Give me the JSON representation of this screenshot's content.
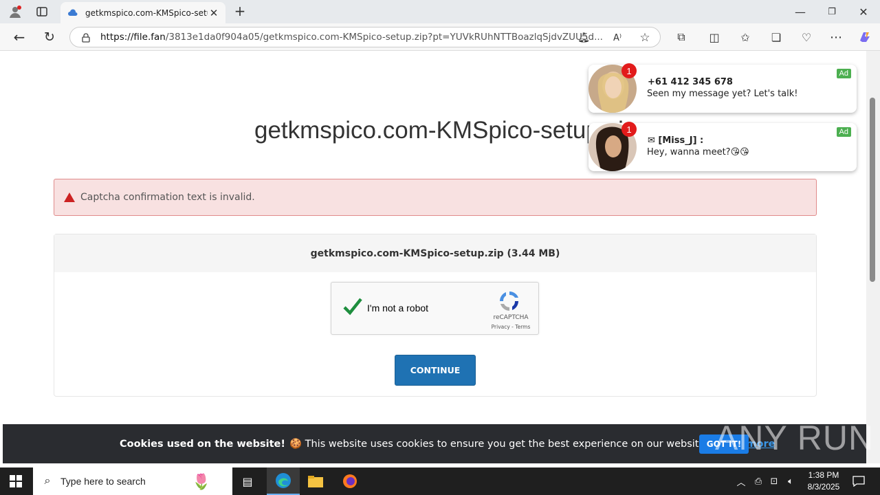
{
  "browser": {
    "tab_title": "getkmspico.com-KMSpico-setup.zip",
    "url_domain": "https://file.fan",
    "url_path": "/3813e1da0f904a05/getkmspico.com-KMSpico-setup.zip?pt=YUVkRUhNTTBoazlqSjdvZUU5d..."
  },
  "page": {
    "title": "getkmspico.com-KMSpico-setup.zip",
    "alert_text": "Captcha confirmation text is invalid.",
    "file_info": "getkmspico.com-KMSpico-setup.zip (3.44 MB)",
    "recaptcha": {
      "label": "I'm not a robot",
      "brand": "reCAPTCHA",
      "links": "Privacy - Terms"
    },
    "continue_label": "CONTINUE"
  },
  "ads": [
    {
      "name": "+61 412 345 678",
      "message": "Seen my message yet? Let's talk!",
      "badge": "1",
      "tag": "Ad"
    },
    {
      "name": "✉ [Miss_J] :",
      "message": "Hey, wanna meet?😘😘",
      "badge": "1",
      "tag": "Ad"
    }
  ],
  "cookie": {
    "heading": "Cookies used on the website!",
    "text": "🍪 This website uses cookies to ensure you get the best experience on our website.",
    "learn_more": "Learn more",
    "button": "GOT IT!"
  },
  "watermark": "ANY RUN",
  "taskbar": {
    "search_placeholder": "Type here to search",
    "time": "1:38 PM",
    "date": "8/3/2025"
  },
  "colors": {
    "accent": "#1f72b3",
    "alert_bg": "#f8e1e1",
    "ad_green": "#4caf50"
  }
}
